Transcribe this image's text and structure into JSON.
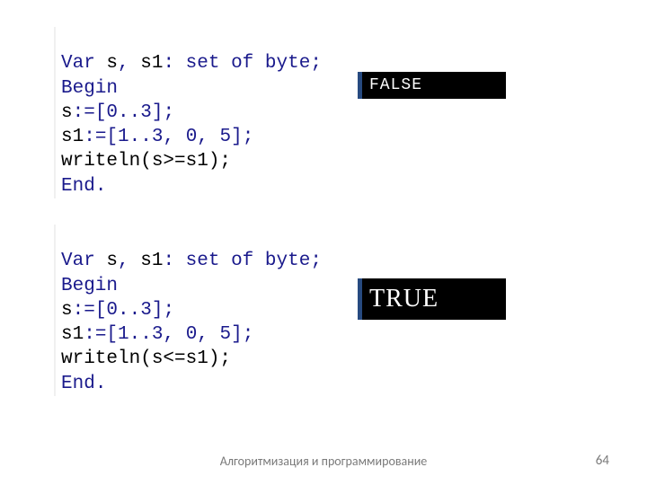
{
  "code1": {
    "l1a": "Var",
    "l1b": " s",
    "l1c": ",",
    "l1d": " s1",
    "l1e": ":",
    "l1f": " set of ",
    "l1g": "byte",
    "l1h": ";",
    "l2": "Begin",
    "l3a": "s",
    "l3b": ":=[",
    "l3c": "0",
    "l3d": "..",
    "l3e": "3",
    "l3f": "];",
    "l4a": "s1",
    "l4b": ":=[",
    "l4c": "1",
    "l4d": "..",
    "l4e": "3",
    "l4f": ", ",
    "l4g": "0",
    "l4h": ", ",
    "l4i": "5",
    "l4j": "];",
    "l5a": "writeln",
    "l5b": "(s>=s1);",
    "l6a": "End",
    "l6b": "."
  },
  "output1": "FALSE",
  "code2": {
    "l1a": "Var",
    "l1b": " s",
    "l1c": ",",
    "l1d": " s1",
    "l1e": ":",
    "l1f": " set of ",
    "l1g": "byte",
    "l1h": ";",
    "l2": "Begin",
    "l3a": "s",
    "l3b": ":=[",
    "l3c": "0",
    "l3d": "..",
    "l3e": "3",
    "l3f": "];",
    "l4a": "s1",
    "l4b": ":=[",
    "l4c": "1",
    "l4d": "..",
    "l4e": "3",
    "l4f": ", ",
    "l4g": "0",
    "l4h": ", ",
    "l4i": "5",
    "l4j": "];",
    "l5a": "writeln",
    "l5b": "(s<=s1);",
    "l6a": "End",
    "l6b": "."
  },
  "output2": "TRUE",
  "footer": "Алгоритмизация и программирование",
  "page": "64"
}
